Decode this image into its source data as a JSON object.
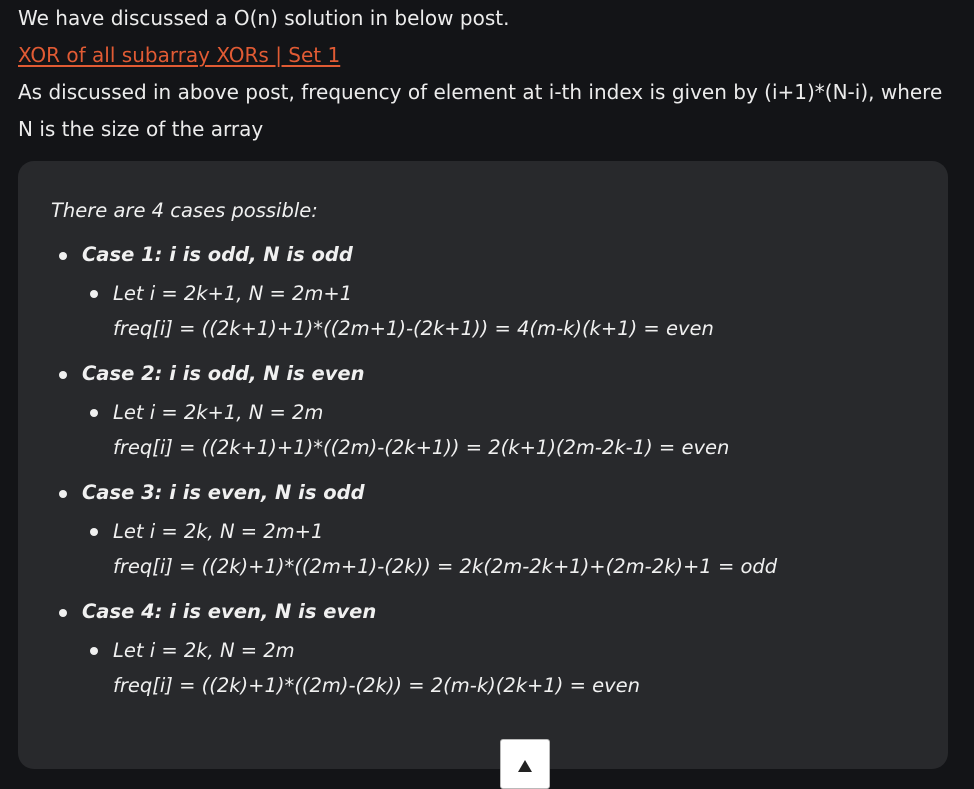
{
  "intro": {
    "line1": "We have discussed a O(n) solution in below post.",
    "link_text": "XOR of all subarray XORs | Set 1",
    "line2": "As discussed in above post, frequency of element at i-th index is given by (i+1)*(N-i), where N is the size of the array"
  },
  "card": {
    "lead": "There are 4 cases possible:",
    "cases": [
      {
        "title": "Case 1: i is odd, N is odd",
        "let": "Let i = 2k+1, N = 2m+1",
        "freq": "freq[i] = ((2k+1)+1)*((2m+1)-(2k+1)) = 4(m-k)(k+1) = even"
      },
      {
        "title": "Case 2: i is odd, N is even",
        "let": "Let i = 2k+1, N = 2m",
        "freq": "freq[i] = ((2k+1)+1)*((2m)-(2k+1)) = 2(k+1)(2m-2k-1) = even"
      },
      {
        "title": "Case 3: i is even, N is odd",
        "let": "Let i = 2k, N = 2m+1",
        "freq": "freq[i] = ((2k)+1)*((2m+1)-(2k)) = 2k(2m-2k+1)+(2m-2k)+1 = odd"
      },
      {
        "title": "Case 4: i is even, N is even",
        "let": "Let i = 2k, N = 2m",
        "freq": "freq[i] = ((2k)+1)*((2m)-(2k)) = 2(m-k)(2k+1) = even"
      }
    ]
  },
  "scroll_top": {
    "icon": "arrow-up-icon"
  }
}
